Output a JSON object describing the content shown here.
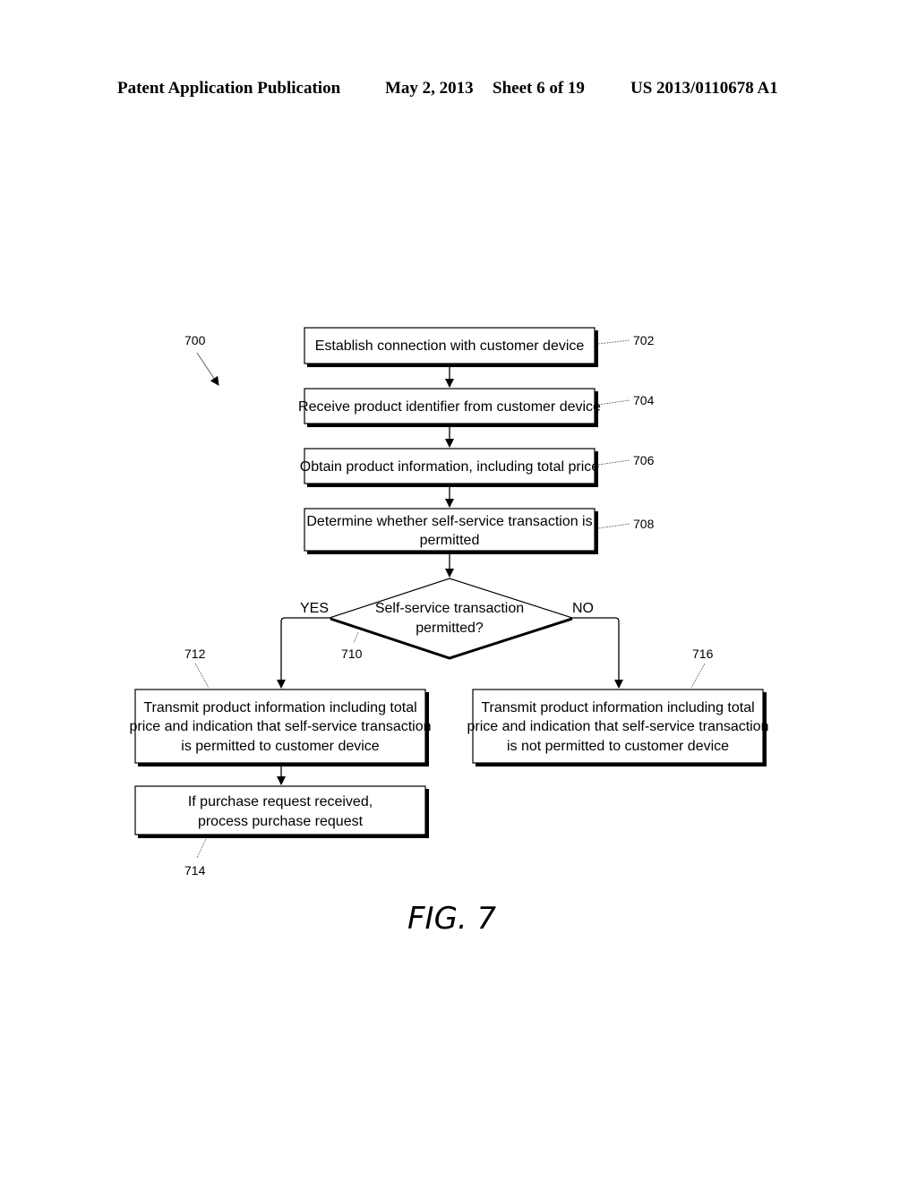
{
  "header": {
    "publication": "Patent Application Publication",
    "date": "May 2, 2013",
    "sheet": "Sheet 6 of 19",
    "number": "US 2013/0110678 A1"
  },
  "diagram": {
    "ref": "700",
    "steps": [
      {
        "ref": "702",
        "lines": [
          "Establish connection with customer device"
        ]
      },
      {
        "ref": "704",
        "lines": [
          "Receive product identifier from customer device"
        ]
      },
      {
        "ref": "706",
        "lines": [
          "Obtain product information, including total price"
        ]
      },
      {
        "ref": "708",
        "lines": [
          "Determine whether self-service transaction is",
          "permitted"
        ]
      }
    ],
    "decision": {
      "ref": "710",
      "lines": [
        "Self-service transaction",
        "permitted?"
      ],
      "yes_label": "YES",
      "no_label": "NO"
    },
    "yes_branch": [
      {
        "ref": "712",
        "lines": [
          "Transmit product information including total",
          "price and indication that self-service transaction",
          "is permitted to customer device"
        ]
      },
      {
        "ref": "714",
        "lines": [
          "If purchase request received,",
          "process purchase request"
        ]
      }
    ],
    "no_branch": [
      {
        "ref": "716",
        "lines": [
          "Transmit product information including total",
          "price and indication that self-service transaction",
          "is not permitted to customer device"
        ]
      }
    ],
    "figure_label": "FIG. 7"
  }
}
